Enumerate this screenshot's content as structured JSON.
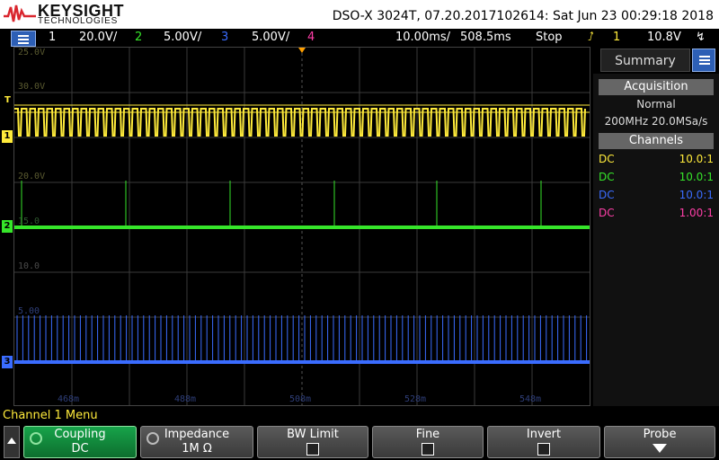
{
  "brand": {
    "name": "KEYSIGHT",
    "sub": "TECHNOLOGIES"
  },
  "header": {
    "model_line": "DSO-X 3024T, 07.20.2017102614: Sat Jun 23 00:29:18 2018"
  },
  "statusbar": {
    "ch1": {
      "num": "1",
      "scale": "20.0V/",
      "color": "#ffeb3b"
    },
    "ch2": {
      "num": "2",
      "scale": "5.00V/",
      "color": "#36e52a"
    },
    "ch3": {
      "num": "3",
      "scale": "5.00V/",
      "color": "#3a6cff"
    },
    "ch4": {
      "num": "4",
      "color": "#ff3fa8"
    },
    "timebase": "10.00ms/",
    "delay": "508.5ms",
    "run_state": "Stop",
    "trigger_source": "1",
    "trigger_level": "10.8V"
  },
  "scope": {
    "ch1_labels": [
      "25.0V",
      "30.0V",
      "20.0V"
    ],
    "ch2_labels": [
      "15.0",
      "10.0"
    ],
    "ch3_labels": [
      "5.00"
    ],
    "time_labels": [
      "468m",
      "488m",
      "508m",
      "528m",
      "548m"
    ],
    "marker_1": "1",
    "marker_2": "2",
    "marker_3": "3",
    "trig_marker": "T"
  },
  "summary": {
    "title": "Summary",
    "acq_title": "Acquisition",
    "acq_mode": "Normal",
    "acq_rate": "200MHz  20.0MSa/s",
    "channels_title": "Channels",
    "channels": [
      {
        "coupling": "DC",
        "ratio": "10.0:1",
        "color": "#ffeb3b"
      },
      {
        "coupling": "DC",
        "ratio": "10.0:1",
        "color": "#36e52a"
      },
      {
        "coupling": "DC",
        "ratio": "10.0:1",
        "color": "#3a6cff"
      },
      {
        "coupling": "DC",
        "ratio": "1.00:1",
        "color": "#ff3fa8"
      }
    ]
  },
  "menu": {
    "title": "Channel 1 Menu",
    "keys": [
      {
        "label": "Coupling",
        "value": "DC"
      },
      {
        "label": "Impedance",
        "value": "1M Ω"
      },
      {
        "label": "BW Limit",
        "value": ""
      },
      {
        "label": "Fine",
        "value": ""
      },
      {
        "label": "Invert",
        "value": ""
      },
      {
        "label": "Probe",
        "value": ""
      }
    ]
  }
}
